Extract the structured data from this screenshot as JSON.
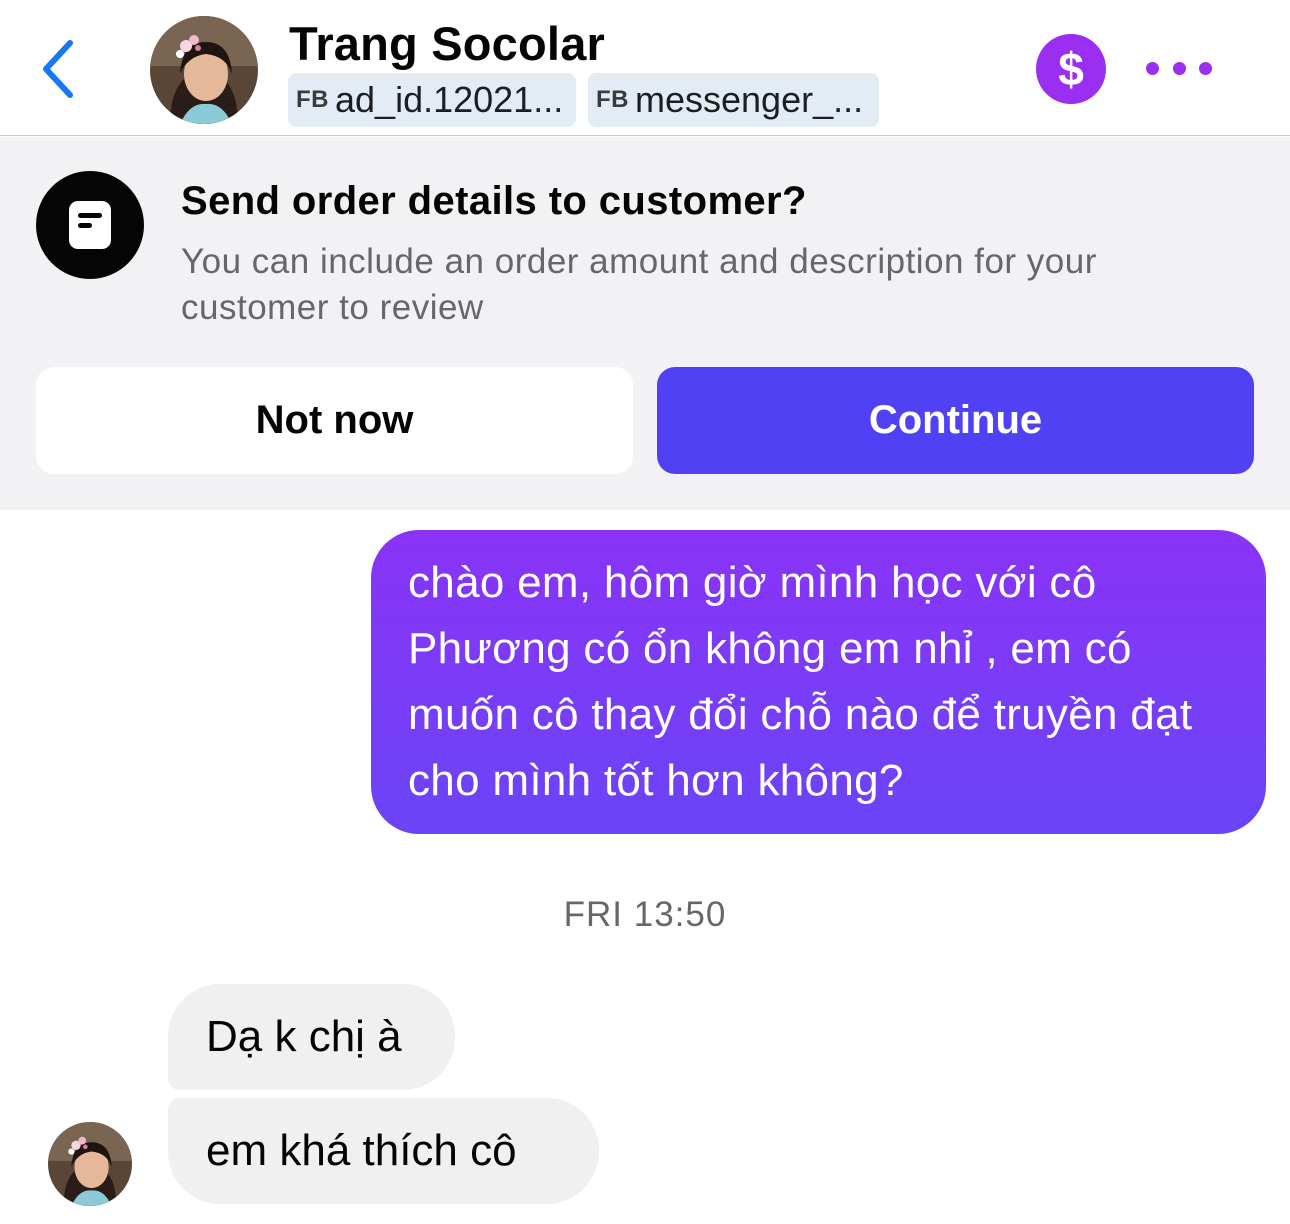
{
  "header": {
    "contact_name": "Trang Socolar",
    "tags": [
      {
        "prefix": "FB",
        "label": "ad_id.12021..."
      },
      {
        "prefix": "FB",
        "label": "messenger_..."
      }
    ],
    "dollar_symbol": "$",
    "icons": {
      "back": "chevron-left-icon",
      "payment": "dollar-icon",
      "more": "more-dots-icon"
    },
    "accent_color": "#9a2ff2"
  },
  "banner": {
    "title": "Send order details to customer?",
    "description": "You can include an order amount and description for your customer to review",
    "not_now_label": "Not now",
    "continue_label": "Continue",
    "icon": "order-document-icon"
  },
  "messages": {
    "outgoing": [
      {
        "text": "chào em, hôm giờ mình học với cô Phương có ổn không em nhỉ , em có muốn cô thay đổi chỗ nào để truyền đạt cho mình tốt hơn không?"
      }
    ],
    "timestamp": "FRI 13:50",
    "incoming": [
      {
        "text": "Dạ k chị à"
      },
      {
        "text": "em khá thích cô"
      }
    ]
  }
}
